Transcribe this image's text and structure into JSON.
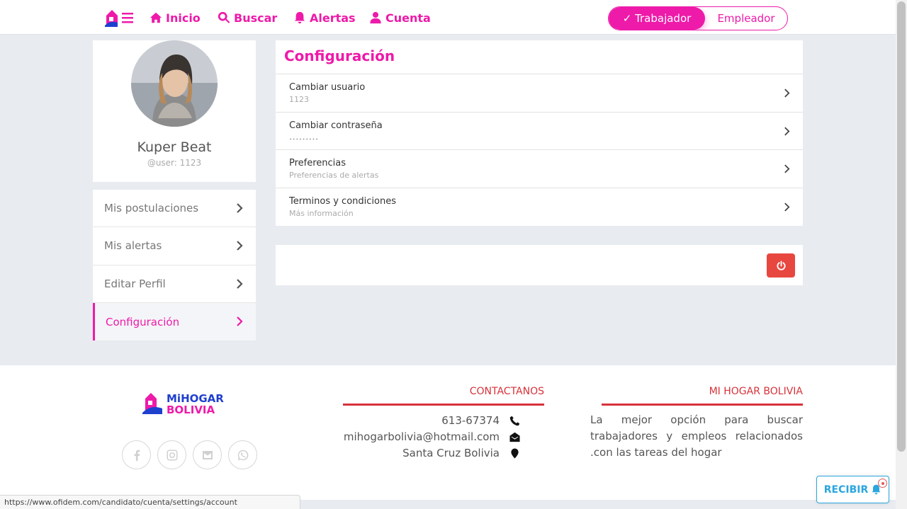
{
  "nav": {
    "items": [
      {
        "label": "Inicio",
        "icon": "home-icon"
      },
      {
        "label": "Buscar",
        "icon": "search-icon"
      },
      {
        "label": "Alertas",
        "icon": "bell-icon"
      },
      {
        "label": "Cuenta",
        "icon": "user-icon"
      }
    ],
    "mode_active": "✓ Trabajador",
    "mode_inactive": "Empleador"
  },
  "profile": {
    "name": "Kuper Beat",
    "handle": "@user: 1123"
  },
  "side_menu": [
    {
      "label": "Mis postulaciones",
      "active": false
    },
    {
      "label": "Mis alertas",
      "active": false
    },
    {
      "label": "Editar Perfil",
      "active": false
    },
    {
      "label": "Configuración",
      "active": true
    }
  ],
  "settings": {
    "title": "Configuración",
    "rows": [
      {
        "title": "Cambiar usuario",
        "sub": "1123"
      },
      {
        "title": "Cambiar contraseña",
        "sub": "•••••••••"
      },
      {
        "title": "Preferencias",
        "sub": "Preferencias de alertas"
      },
      {
        "title": "Terminos y condiciones",
        "sub": "Más información"
      }
    ]
  },
  "footer": {
    "logo_line1": "MiHOGAR",
    "logo_line2": "BOLIVIA",
    "contact_heading": "CONTACTANOS",
    "phone": "613-67374",
    "email": "mihogarbolivia@hotmail.com",
    "location": "Santa Cruz Bolivia",
    "about_heading": "MI HOGAR BOLIVIA",
    "about_text": "La mejor opción para buscar trabajadores y empleos relacionados .con las tareas del hogar"
  },
  "status_url": "https://www.ofidem.com/candidato/cuenta/settings/account",
  "recibir_label": "RECIBIR",
  "colors": {
    "accent": "#ee1aa9",
    "danger": "#e8473f",
    "footer_red": "#d7323a",
    "recibir_blue": "#2aa6de",
    "page_bg": "#e8ebef"
  }
}
